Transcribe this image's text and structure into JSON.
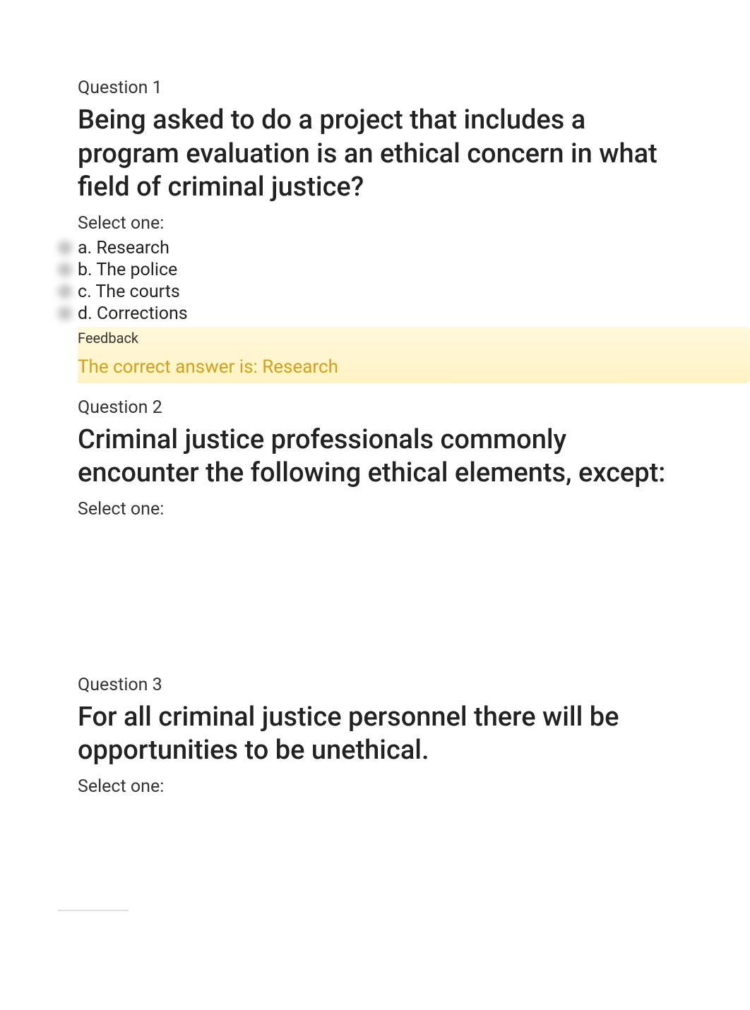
{
  "questions": [
    {
      "label": "Question 1",
      "text": "Being asked to do a project that includes a program evaluation is an ethical concern in what field of criminal justice?",
      "select_prompt": "Select one:",
      "options": [
        "a. Research",
        "b. The police",
        "c. The courts",
        "d. Corrections"
      ],
      "feedback_label": "Feedback",
      "feedback_text": "The correct answer is: Research"
    },
    {
      "label": "Question 2",
      "text": "Criminal justice professionals commonly encounter the following ethical elements, except:",
      "select_prompt": "Select one:"
    },
    {
      "label": "Question 3",
      "text": "For all criminal justice personnel there will be opportunities to be unethical.",
      "select_prompt": "Select one:"
    }
  ]
}
